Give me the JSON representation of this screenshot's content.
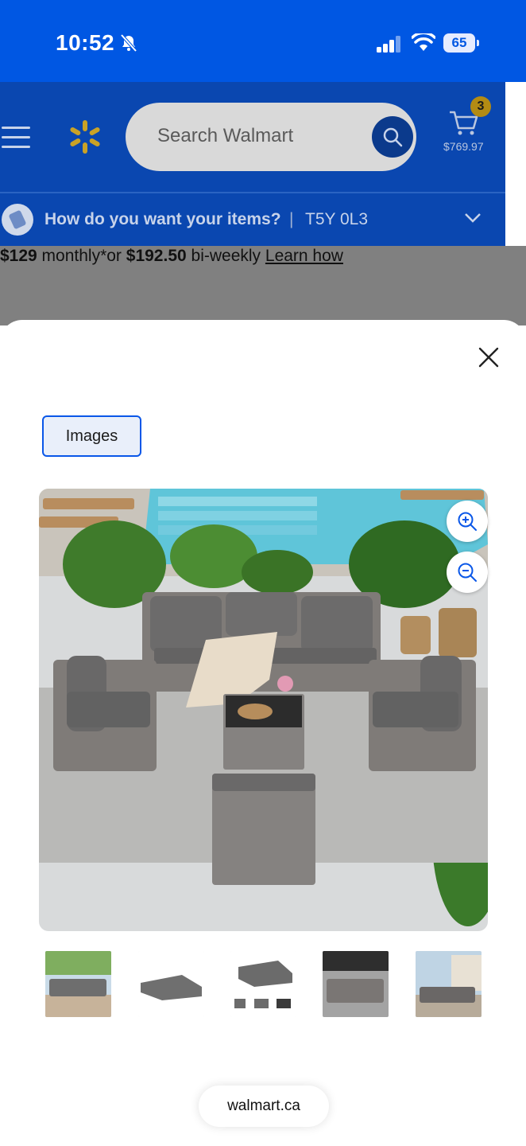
{
  "status_bar": {
    "time": "10:52",
    "battery": "65"
  },
  "header": {
    "search_placeholder": "Search Walmart",
    "cart_count": "3",
    "cart_total": "$769.97",
    "delivery_prompt": "How do you want your items?",
    "separator": "|",
    "postal_code": "T5Y 0L3"
  },
  "payment": {
    "monthly_amount": "$129",
    "monthly_text": " monthly*or ",
    "biweekly_amount": "$192.50",
    "biweekly_text": " bi-weekly ",
    "learn_link": "Learn how"
  },
  "viewer": {
    "tab_label": "Images",
    "thumbnails": [
      "thumb-1",
      "thumb-2",
      "thumb-3",
      "thumb-4",
      "thumb-5"
    ]
  },
  "browser": {
    "url": "walmart.ca"
  },
  "colors": {
    "brand_blue": "#0057e3",
    "accent_yellow": "#ffc220",
    "focus_blue": "#0a57e8"
  }
}
